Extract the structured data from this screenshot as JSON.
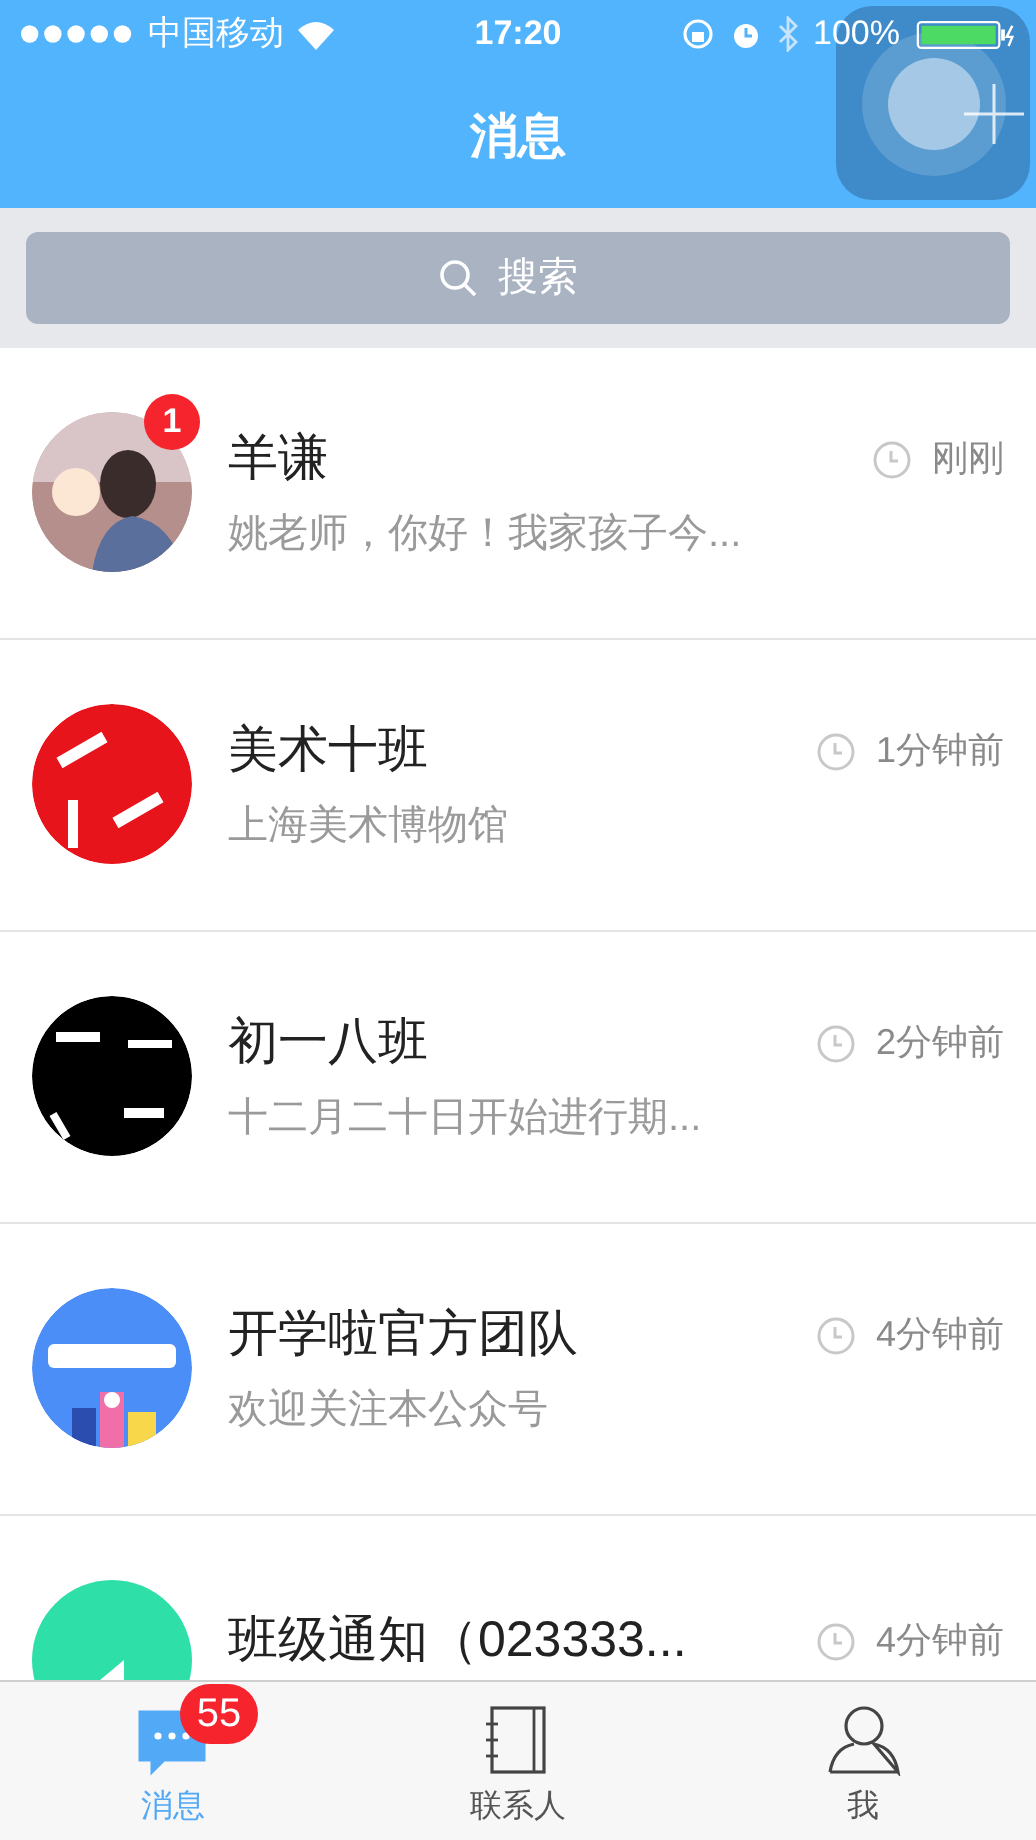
{
  "status_bar": {
    "carrier": "中国移动",
    "time": "17:20",
    "battery": "100%"
  },
  "nav": {
    "title": "消息"
  },
  "search": {
    "placeholder": "搜索"
  },
  "conversations": [
    {
      "name": "羊谦",
      "preview": "姚老师，你好！我家孩子今...",
      "time": "刚刚",
      "unread": "1",
      "avatar": {
        "kind": "portrait"
      }
    },
    {
      "name": "美术十班",
      "preview": "上海美术博物馆",
      "time": "1分钟前",
      "avatar": {
        "kind": "red-logo"
      }
    },
    {
      "name": "初一八班",
      "preview": "十二月二十日开始进行期...",
      "time": "2分钟前",
      "avatar": {
        "kind": "black-logo"
      }
    },
    {
      "name": "开学啦官方团队",
      "preview": "欢迎关注本公众号",
      "time": "4分钟前",
      "avatar": {
        "kind": "blue-logo"
      }
    },
    {
      "name": "班级通知（023333...",
      "time": "4分钟前",
      "avatar": {
        "kind": "green-speaker"
      }
    }
  ],
  "tab_bar": [
    {
      "label": "消息",
      "selected": true,
      "badge": "55",
      "kind": "messages"
    },
    {
      "label": "联系人",
      "selected": false,
      "kind": "contacts"
    },
    {
      "label": "我",
      "selected": false,
      "kind": "me"
    }
  ]
}
